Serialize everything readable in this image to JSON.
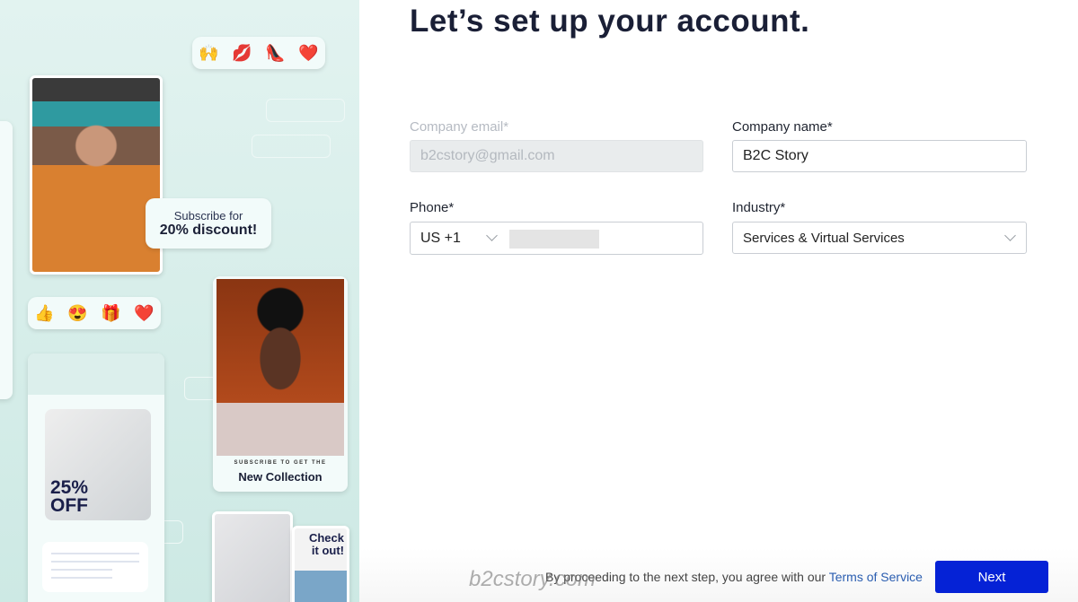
{
  "promo": {
    "emoji_row_1": [
      "🙌",
      "💋",
      "👠",
      "❤️"
    ],
    "emoji_row_2": [
      "👍",
      "😍",
      "🎁",
      "❤️"
    ],
    "subscribe_line1": "Subscribe for",
    "subscribe_line2": "20% discount!",
    "collection_small": "SUBSCRIBE TO GET THE",
    "collection_big": "New Collection",
    "sale_line1": "25%",
    "sale_line2": "OFF",
    "check_out": "Check it out!"
  },
  "form": {
    "title": "Let’s set up your account.",
    "email_label": "Company email*",
    "email_value": "b2cstory@gmail.com",
    "company_label": "Company name*",
    "company_value": "B2C Story",
    "phone_label": "Phone*",
    "phone_country": "US +1",
    "industry_label": "Industry*",
    "industry_value": "Services & Virtual Services"
  },
  "footer": {
    "agree_text": "By proceeding to the next step, you agree with our ",
    "terms_link": "Terms of Service",
    "next_label": "Next",
    "watermark": "b2cstory.com"
  }
}
